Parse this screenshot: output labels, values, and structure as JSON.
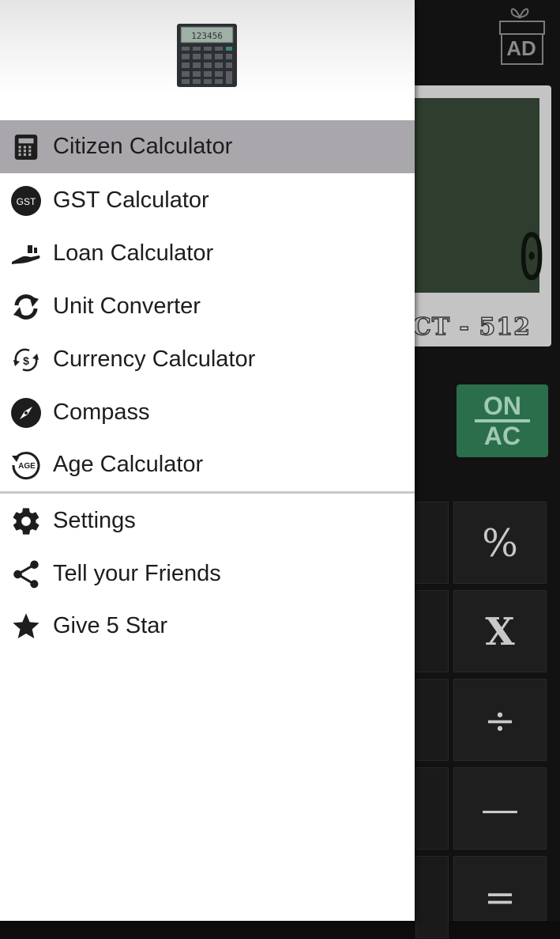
{
  "calculator": {
    "ad_badge": "AD",
    "display_value": "0",
    "model": "CT - 512",
    "keys": {
      "on_ac_top": "ON",
      "on_ac_bottom": "AC",
      "percent": "%",
      "multiply": "X",
      "divide": "÷",
      "minus": "—",
      "equals": "="
    },
    "accent_color": "#2b6e4c"
  },
  "drawer": {
    "active_color": "#a9a7ab",
    "primary_items": [
      {
        "label": "Citizen Calculator",
        "icon": "calculator-icon",
        "active": true
      },
      {
        "label": "GST Calculator",
        "icon": "gst-icon",
        "active": false
      },
      {
        "label": "Loan Calculator",
        "icon": "loan-hand-icon",
        "active": false
      },
      {
        "label": "Unit Converter",
        "icon": "convert-arrows-icon",
        "active": false
      },
      {
        "label": "Currency Calculator",
        "icon": "currency-exchange-icon",
        "active": false
      },
      {
        "label": "Compass",
        "icon": "compass-icon",
        "active": false
      },
      {
        "label": "Age Calculator",
        "icon": "age-icon",
        "active": false
      }
    ],
    "secondary_items": [
      {
        "label": "Settings",
        "icon": "gear-icon"
      },
      {
        "label": "Tell your Friends",
        "icon": "share-icon"
      },
      {
        "label": "Give 5 Star",
        "icon": "star-icon"
      }
    ],
    "gst_icon_text": "GST",
    "age_icon_text": "AGE",
    "currency_icon_text": "$"
  }
}
